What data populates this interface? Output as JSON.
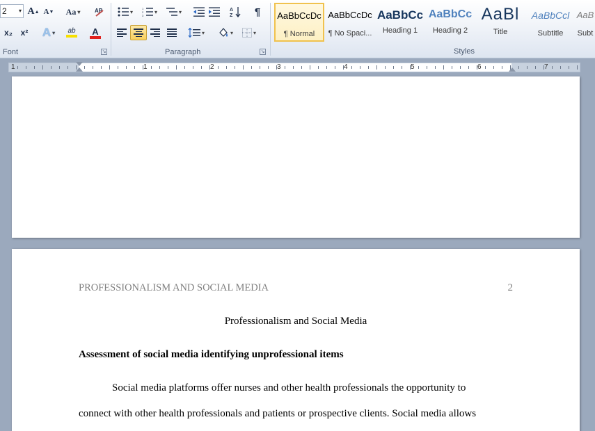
{
  "ribbon": {
    "font_group": {
      "label": "Font",
      "font_size": "2",
      "grow_font": "A",
      "shrink_font": "A",
      "change_case": "Aa",
      "subscript": "x₂",
      "superscript": "x²",
      "text_effects": "A",
      "highlight": "ab",
      "font_color": "A"
    },
    "paragraph_group": {
      "label": "Paragraph",
      "pilcrow": "¶"
    },
    "styles_group": {
      "label": "Styles",
      "items": [
        {
          "sample": "AaBbCcDc",
          "name": "¶ Normal"
        },
        {
          "sample": "AaBbCcDc",
          "name": "¶ No Spaci..."
        },
        {
          "sample": "AaBbCc",
          "name": "Heading 1"
        },
        {
          "sample": "AaBbCc",
          "name": "Heading 2"
        },
        {
          "sample": "AaBl",
          "name": "Title"
        },
        {
          "sample": "AaBbCcl",
          "name": "Subtitle"
        },
        {
          "sample": "AaB",
          "name": "Subt"
        }
      ]
    },
    "colors": {
      "highlight": "#f7e000",
      "font_color": "#e0201c",
      "heading_blue": "#17365d",
      "heading2_blue": "#4f81bd"
    }
  },
  "ruler": {
    "numbers": [
      "1",
      "1",
      "2",
      "3",
      "4",
      "5",
      "6",
      "7"
    ]
  },
  "document": {
    "running_head": "PROFESSIONALISM AND SOCIAL MEDIA",
    "page_number": "2",
    "title": "Professionalism  and Social Media",
    "heading": "Assessment of social media identifying unprofessional items",
    "paragraph_line1": "Social media platforms offer nurses and other health professionals the opportunity to",
    "paragraph_line2": "connect with other health professionals  and patients or prospective clients.  Social media allows"
  }
}
